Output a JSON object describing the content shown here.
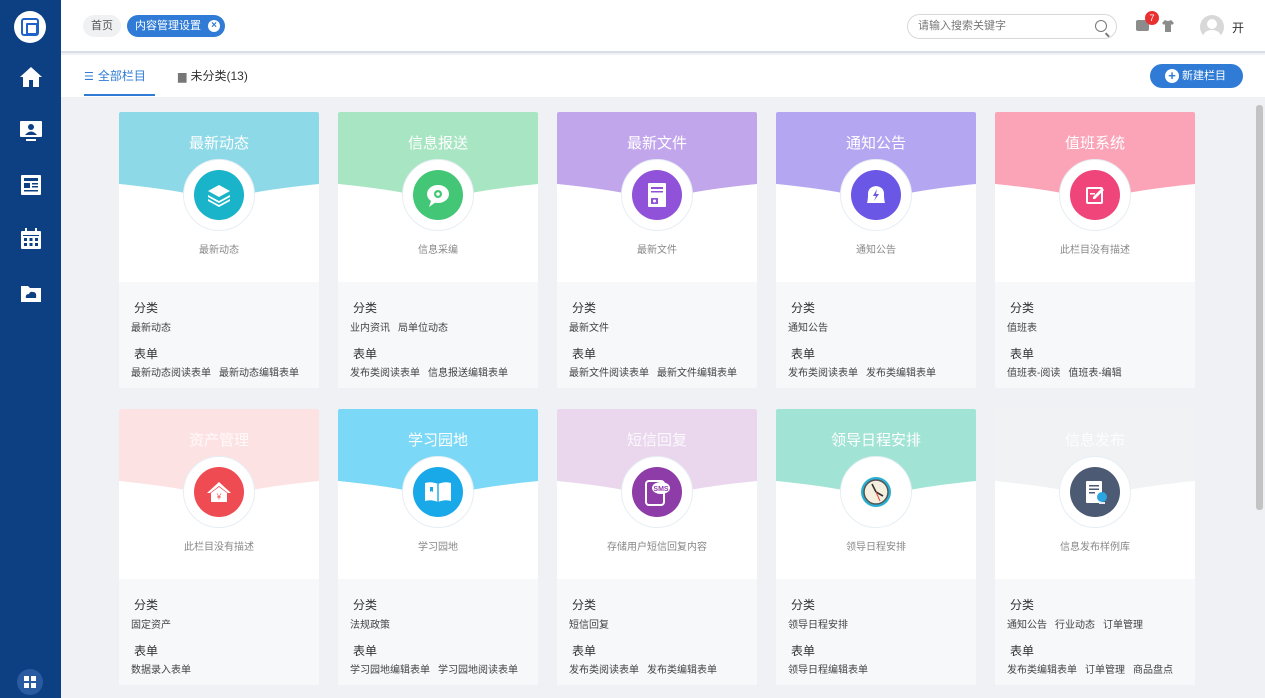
{
  "header": {
    "breadcrumbs": [
      "首页",
      "内容管理设置"
    ],
    "search_placeholder": "请输入搜索关键字",
    "notification_count": "7",
    "user_name": "开"
  },
  "tabs": {
    "all_label": "全部栏目",
    "uncategorized_label": "未分类(13)",
    "new_button_label": "新建栏目"
  },
  "sidebar": {
    "items": [
      "home-icon",
      "monitor-user-icon",
      "news-icon",
      "calendar-icon",
      "cloud-folder-icon"
    ]
  },
  "labels": {
    "category": "分类",
    "form": "表单"
  },
  "cards": [
    {
      "title": "最新动态",
      "desc": "最新动态",
      "color": "#8dd9e8",
      "icon_color": "#19b4c9",
      "icon": "layers-icon",
      "categories": [
        "最新动态"
      ],
      "forms": [
        "最新动态阅读表单",
        "最新动态编辑表单"
      ]
    },
    {
      "title": "信息报送",
      "desc": "信息采编",
      "color": "#a8e6c3",
      "icon_color": "#43c777",
      "icon": "chat-gear-icon",
      "categories": [
        "业内资讯",
        "局单位动态"
      ],
      "forms": [
        "发布类阅读表单",
        "信息报送编辑表单"
      ]
    },
    {
      "title": "最新文件",
      "desc": "最新文件",
      "color": "#c2a6ec",
      "icon_color": "#8f52d8",
      "icon": "document-icon",
      "categories": [
        "最新文件"
      ],
      "forms": [
        "最新文件阅读表单",
        "最新文件编辑表单"
      ]
    },
    {
      "title": "通知公告",
      "desc": "通知公告",
      "color": "#b5a6f2",
      "icon_color": "#6b57e6",
      "icon": "bell-icon",
      "categories": [
        "通知公告"
      ],
      "forms": [
        "发布类阅读表单",
        "发布类编辑表单"
      ]
    },
    {
      "title": "值班系统",
      "desc": "此栏目没有描述",
      "color": "#fba3b7",
      "icon_color": "#f0457a",
      "icon": "edit-icon",
      "categories": [
        "值班表"
      ],
      "forms": [
        "值班表-阅读",
        "值班表-编辑"
      ]
    },
    {
      "title": "资产管理",
      "desc": "此栏目没有描述",
      "color": "#fde2e4",
      "icon_color": "#ef4b52",
      "icon": "house-yen-icon",
      "categories": [
        "固定资产"
      ],
      "forms": [
        "数据录入表单"
      ]
    },
    {
      "title": "学习园地",
      "desc": "学习园地",
      "color": "#7bd8f6",
      "icon_color": "#1aa9e8",
      "icon": "book-icon",
      "categories": [
        "法规政策"
      ],
      "forms": [
        "学习园地编辑表单",
        "学习园地阅读表单"
      ]
    },
    {
      "title": "短信回复",
      "desc": "存储用户短信回复内容",
      "color": "#ead7ee",
      "icon_color": "#8e3ca7",
      "icon": "sms-icon",
      "categories": [
        "短信回复"
      ],
      "forms": [
        "发布类阅读表单",
        "发布类编辑表单"
      ]
    },
    {
      "title": "领导日程安排",
      "desc": "领导日程安排",
      "color": "#a1e3d4",
      "icon_color": "#2aaed1",
      "icon": "clock-icon",
      "categories": [
        "领导日程安排"
      ],
      "forms": [
        "领导日程编辑表单"
      ]
    },
    {
      "title": "信息发布",
      "desc": "信息发布样例库",
      "color": "#f1f2f4",
      "icon_color": "#4d5a73",
      "icon": "file-stamp-icon",
      "categories": [
        "通知公告",
        "行业动态",
        "订单管理"
      ],
      "forms": [
        "发布类编辑表单",
        "订单管理",
        "商品盘点"
      ]
    }
  ]
}
